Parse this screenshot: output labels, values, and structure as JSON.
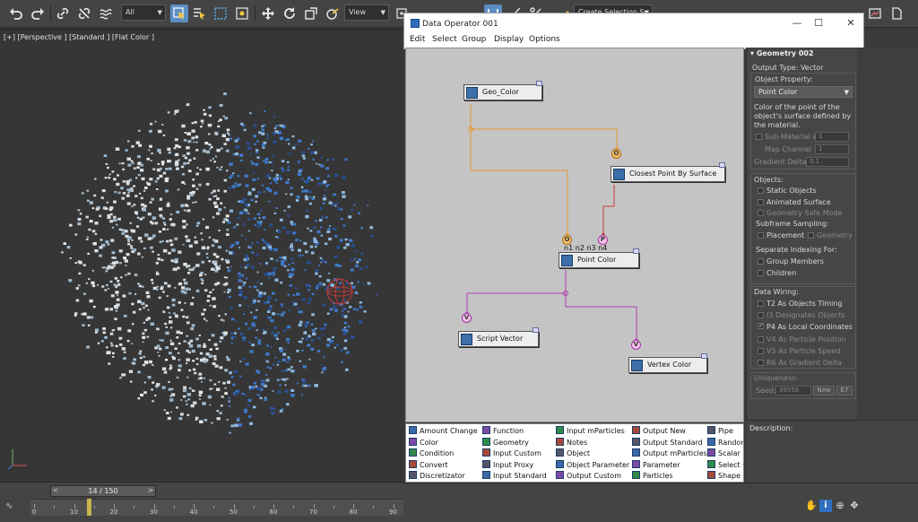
{
  "toolbar": {
    "filter_select": "All",
    "view_select": "View",
    "named_selection": "Create Selection Se",
    "icons": [
      "undo-icon",
      "redo-icon",
      "link-icon",
      "unlink-icon",
      "bind-space-warp-icon",
      "select-icon",
      "select-by-name-icon",
      "rect-selection-icon",
      "window-crossing-icon",
      "move-icon",
      "rotate-icon",
      "scale-icon",
      "select-manipulate-icon"
    ]
  },
  "viewport": {
    "label": "[+] [Perspective ] [Standard ] [Flat Color ]"
  },
  "timeline": {
    "frame_display": "14 / 150",
    "prev": "<",
    "next": ">",
    "ticks": [
      "0",
      "10",
      "20",
      "30",
      "40",
      "50",
      "60",
      "70",
      "80",
      "90"
    ]
  },
  "dop_window": {
    "title": "Data Operator 001",
    "menu": [
      "Edit",
      "Select",
      "Group",
      "Display",
      "Options"
    ],
    "controls": {
      "minimize": "—",
      "maximize": "☐",
      "close": "✕"
    }
  },
  "graph": {
    "nodes": [
      {
        "id": "geo_color",
        "label": "Geo_Color"
      },
      {
        "id": "closest_point",
        "label": "Closest Point By Surface"
      },
      {
        "id": "point_color",
        "label": "Point Color"
      },
      {
        "id": "script_vector",
        "label": "Script Vector"
      },
      {
        "id": "vertex_color",
        "label": "Vertex Color"
      }
    ],
    "pins": {
      "o": "O",
      "p": "P",
      "v": "V"
    },
    "point_color_inputs": "n1 n2 n3 n4"
  },
  "palette": {
    "columns": [
      [
        "Amount Change",
        "Color",
        "Condition",
        "Convert",
        "Discretizator"
      ],
      [
        "Function",
        "Geometry",
        "Input Custom",
        "Input Proxy",
        "Input Standard"
      ],
      [
        "Input mParticles",
        "Notes",
        "Object",
        "Object Parameter",
        "Output Custom"
      ],
      [
        "Output New",
        "Output Standard",
        "Output mParticles",
        "Parameter",
        "Particles"
      ],
      [
        "Pipe",
        "Random",
        "Scalar",
        "Select C",
        "Shape C"
      ]
    ]
  },
  "rpanel": {
    "header": "Geometry 002",
    "output_type": "Output Type: Vector",
    "object_property_label": "Object Property:",
    "object_property_value": "Point Color",
    "description": [
      "Color of the point of the",
      "object's surface defined by",
      "the material."
    ],
    "sub_material_label": "Sub-Material #",
    "sub_material_value": "1",
    "map_channel_label": "Map Channel #",
    "map_channel_value": "1",
    "gradient_delta_label": "Gradient Delta:",
    "gradient_delta_value": "0.1",
    "objects_label": "Objects:",
    "static_objects": "Static Objects",
    "animated_surface": "Animated Surface",
    "geometry_safe_mode": "Geometry Safe Mode",
    "subframe_label": "Subframe Sampling:",
    "placement": "Placement",
    "geometry": "Geometry",
    "separate_label": "Separate Indexing For:",
    "group_members": "Group Members",
    "children": "Children",
    "data_wiring_label": "Data Wiring:",
    "t2": "T2 As Objects Timing",
    "i3": "I3 Designates Objects",
    "p4": "P4 As Local Coordinates",
    "v4": "V4 As Particle Position",
    "v5": "V5 As Particle Speed",
    "r6": "R6 As Gradient Delta",
    "uniqueness_label": "Uniqueness:",
    "seed_label": "Seed:",
    "seed_value": "39558",
    "new_button": "New",
    "e7": "E7",
    "description_label": "Description:"
  },
  "colors": {
    "orange_wire": "#e8962e",
    "purple_wire": "#b040b0",
    "red_wire": "#c83a3a",
    "accent": "#5c8ec4"
  }
}
